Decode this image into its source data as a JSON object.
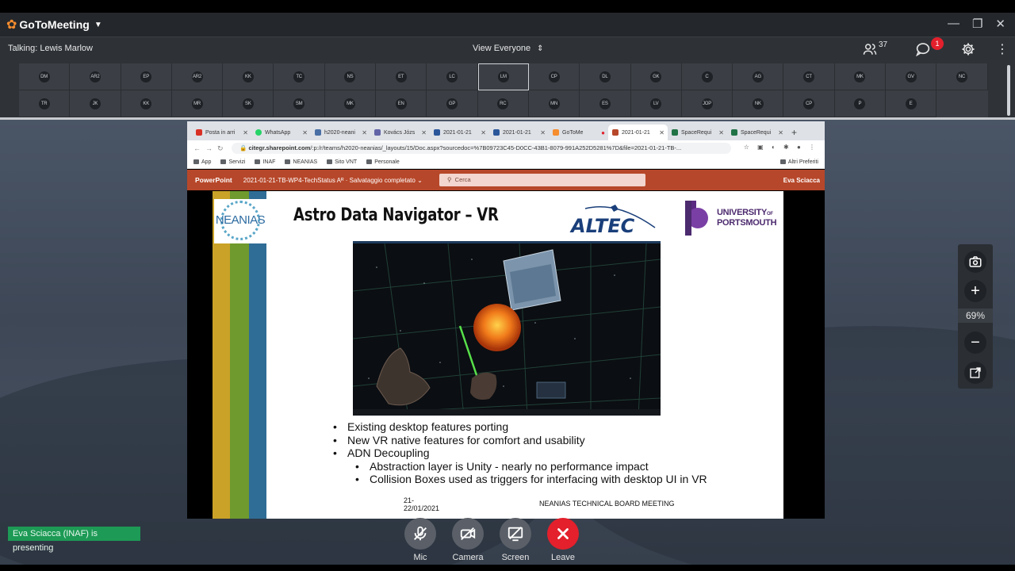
{
  "app": {
    "name": "GoToMeeting",
    "window_controls": [
      "—",
      "❐",
      "✕"
    ]
  },
  "status": {
    "talking": "Talking: Lewis Marlow",
    "view": "View Everyone",
    "participants_count": "37",
    "chat_badge": "1"
  },
  "thumbnails": {
    "row1": [
      "DM",
      "AR2",
      "EP",
      "AR2",
      "KK",
      "TC",
      "NS",
      "ET",
      "LC",
      "LM",
      "CP",
      "DL",
      "GK",
      "C",
      "AG",
      "CT",
      "MK",
      "GV",
      "NC"
    ],
    "row2": [
      "TR",
      "JK",
      "KK",
      "MR",
      "SK",
      "SM",
      "MK",
      "EN",
      "GP",
      "RC",
      "MN",
      "ES",
      "LV",
      "JOP",
      "NK",
      "CP",
      "P",
      "E"
    ],
    "active": "LM"
  },
  "browser": {
    "tabs": [
      {
        "label": "Posta in arri",
        "color": "#d93025"
      },
      {
        "label": "WhatsApp",
        "color": "#25d366"
      },
      {
        "label": "h2020-neani",
        "color": "#4a6fa5"
      },
      {
        "label": "Kovács Józs",
        "color": "#6264a7"
      },
      {
        "label": "2021-01-21",
        "color": "#2b579a"
      },
      {
        "label": "2021-01-21",
        "color": "#2b579a"
      },
      {
        "label": "GoToMe",
        "color": "#f68d2e"
      },
      {
        "label": "2021-01-21",
        "color": "#b7472a",
        "active": true
      },
      {
        "label": "SpaceRequi",
        "color": "#217346"
      },
      {
        "label": "SpaceRequi",
        "color": "#217346"
      }
    ],
    "url_host": "citegr.sharepoint.com",
    "url_path": "/:p:/r/teams/h2020-neanias/_layouts/15/Doc.aspx?sourcedoc=%7B09723C45-D0CC-43B1-8079-991A252D5281%7D&file=2021-01-21-TB-...",
    "bookmarks": [
      "App",
      "Servizi",
      "INAF",
      "NEANIAS",
      "Sito VNT",
      "Personale"
    ],
    "bookmarks_right": "Altri Preferiti"
  },
  "powerpoint": {
    "app": "PowerPoint",
    "document": "2021-01-21-TB-WP4-TechStatus",
    "save_status": "Salvataggio completato",
    "search_placeholder": "Cerca",
    "user": "Eva Sciacca"
  },
  "slide": {
    "logo_text": "NEANIAS",
    "title": "Astro Data Navigator – VR",
    "partner1": "ALTEC",
    "partner2_line1": "UNIVERSITY",
    "partner2_of": "OF",
    "partner2_line2": "PORTSMOUTH",
    "bullets": [
      {
        "text": "Existing desktop features porting",
        "level": 1
      },
      {
        "text": "New VR native features for comfort and usability",
        "level": 1
      },
      {
        "text": "ADN Decoupling",
        "level": 1
      },
      {
        "text": "Abstraction layer is Unity - nearly no performance impact",
        "level": 2
      },
      {
        "text": "Collision Boxes used as triggers for interfacing with desktop UI in VR",
        "level": 2
      }
    ],
    "footer_date_line1": "21-",
    "footer_date_line2": "22/01/2021",
    "footer_meeting": "NEANIAS TECHNICAL BOARD MEETING"
  },
  "zoom": {
    "level": "69%"
  },
  "presenting": "Eva Sciacca (INAF) is presenting",
  "controls": {
    "mic": "Mic",
    "camera": "Camera",
    "screen": "Screen",
    "leave": "Leave"
  },
  "colors": {
    "brand_orange": "#f68d2e",
    "leave_red": "#e3202c",
    "presenting_green": "#1d9a55",
    "ppt_red": "#b7472a"
  }
}
